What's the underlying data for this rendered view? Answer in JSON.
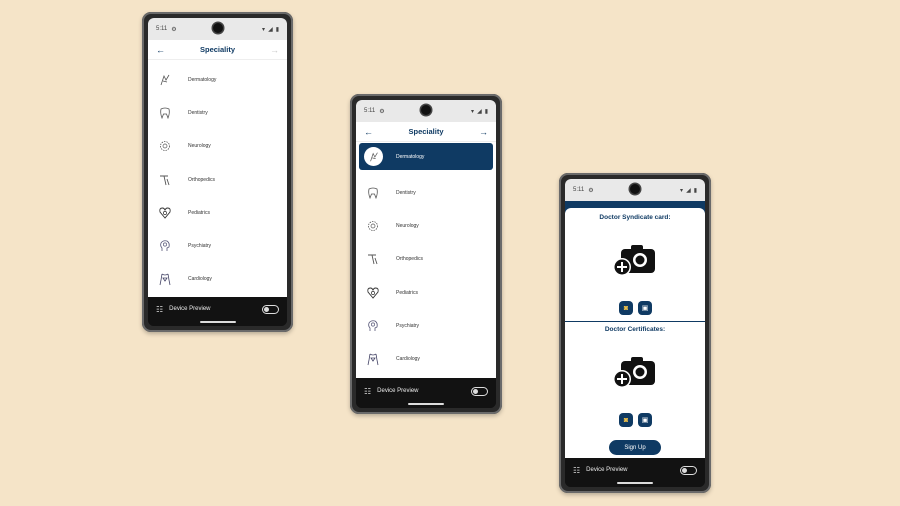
{
  "status": {
    "time": "5:11"
  },
  "speciality_screen": {
    "title": "Speciality",
    "items": [
      {
        "label": "Dermatology",
        "icon": "skin-icon"
      },
      {
        "label": "Dentistry",
        "icon": "tooth-icon"
      },
      {
        "label": "Neurology",
        "icon": "brain-icon"
      },
      {
        "label": "Orthopedics",
        "icon": "bone-icon"
      },
      {
        "label": "Pediatrics",
        "icon": "baby-heart-icon"
      },
      {
        "label": "Psychiatry",
        "icon": "head-icon"
      },
      {
        "label": "Cardiology",
        "icon": "heart-body-icon"
      }
    ]
  },
  "device_preview": {
    "label": "Device Preview"
  },
  "upload_screen": {
    "syndicate_title": "Doctor Syndicate card:",
    "certificates_title": "Doctor Certificates:",
    "signup_label": "Sign Up"
  },
  "colors": {
    "primary": "#0f3a63",
    "background": "#f5e4c8"
  }
}
